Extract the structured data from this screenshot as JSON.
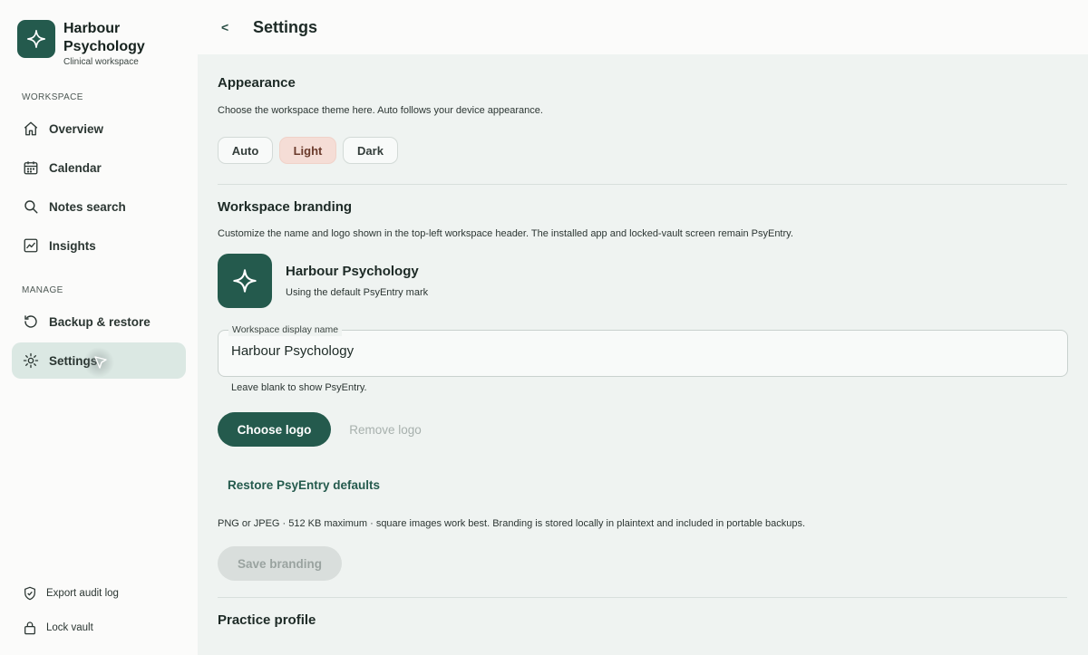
{
  "sidebar": {
    "brand_name": "Harbour Psychology",
    "brand_sub": "Clinical workspace",
    "brand_icon": "sparkle-icon",
    "section_workspace": "WORKSPACE",
    "section_manage": "MANAGE",
    "items": [
      {
        "label": "Overview",
        "icon": "home-icon"
      },
      {
        "label": "Calendar",
        "icon": "calendar-icon"
      },
      {
        "label": "Notes search",
        "icon": "search-icon"
      },
      {
        "label": "Insights",
        "icon": "chart-icon"
      },
      {
        "label": "Backup & restore",
        "icon": "restore-icon"
      },
      {
        "label": "Settings",
        "icon": "gear-icon",
        "active": true
      }
    ],
    "footer": [
      {
        "label": "Export audit log",
        "icon": "shield-check-icon"
      },
      {
        "label": "Lock vault",
        "icon": "lock-icon"
      }
    ]
  },
  "header": {
    "back_label": "<",
    "title": "Settings"
  },
  "appearance": {
    "heading": "Appearance",
    "description": "Choose the workspace theme here. Auto follows your device appearance.",
    "options": [
      "Auto",
      "Light",
      "Dark"
    ],
    "selected": "Light"
  },
  "branding": {
    "heading": "Workspace branding",
    "description": "Customize the name and logo shown in the top-left workspace header. The installed app and locked-vault screen remain PsyEntry.",
    "preview_name": "Harbour Psychology",
    "preview_sub": "Using the default PsyEntry mark",
    "field_label": "Workspace display name",
    "field_value": "Harbour Psychology",
    "field_help": "Leave blank to show PsyEntry.",
    "choose_logo": "Choose logo",
    "remove_logo": "Remove logo",
    "restore_defaults": "Restore PsyEntry defaults",
    "note": "PNG or JPEG · 512 KB maximum · square images work best. Branding is stored locally in plaintext and included in portable backups.",
    "save_label": "Save branding"
  },
  "practice_profile": {
    "heading": "Practice profile"
  },
  "colors": {
    "accent": "#245a4d",
    "selected_chip": "#f5ddd6",
    "active_nav": "#dbe8e3"
  }
}
